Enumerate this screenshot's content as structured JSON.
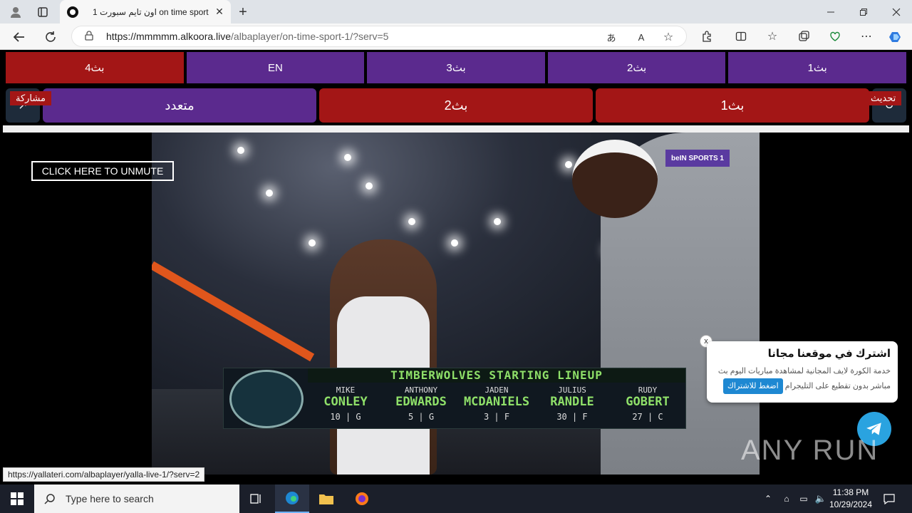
{
  "browser": {
    "tab_title": "اون تايم سبورت 1 on time sport",
    "tab_close": "✕",
    "new_tab": "+",
    "url_host": "https://mmmmm.alkoora.live",
    "url_path": "/albaplayer/on-time-sport-1/?serv=5"
  },
  "servers_row1": [
    "بث1",
    "بث2",
    "بث3",
    "EN",
    "بث4"
  ],
  "servers_row2": [
    "بث1",
    "بث2",
    "متعدد"
  ],
  "side": {
    "refresh_label": "تحديث",
    "share_label": "مشاركة"
  },
  "player": {
    "unmute_label": "CLICK HERE TO UNMUTE",
    "channel_brand": "beIN SPORTS 1",
    "lineup_title": "TIMBERWOLVES STARTING LINEUP",
    "lineup": [
      {
        "first": "MIKE",
        "last": "CONLEY",
        "num": "10 | G"
      },
      {
        "first": "ANTHONY",
        "last": "EDWARDS",
        "num": "5 | G"
      },
      {
        "first": "JADEN",
        "last": "MCDANIELS",
        "num": "3 | F"
      },
      {
        "first": "JULIUS",
        "last": "RANDLE",
        "num": "30 | F"
      },
      {
        "first": "RUDY",
        "last": "GOBERT",
        "num": "27 | C"
      }
    ]
  },
  "popup": {
    "title": "اشترك في موقعنا مجانا",
    "desc": "خدمة الكورة لايف المجانية لمشاهدة مباريات اليوم بث مباشر بدون تقطيع على التليجرام",
    "button": "اضغط للاشتراك",
    "close": "x"
  },
  "watermark": "ANY RUN",
  "status_url": "https://yallateri.com/albaplayer/yalla-live-1/?serv=2",
  "taskbar": {
    "search_placeholder": "Type here to search",
    "time": "11:38 PM",
    "date": "10/29/2024"
  },
  "colors": {
    "purple": "#5b2a8e",
    "red": "#a31616",
    "telegram": "#2aa3e0"
  }
}
